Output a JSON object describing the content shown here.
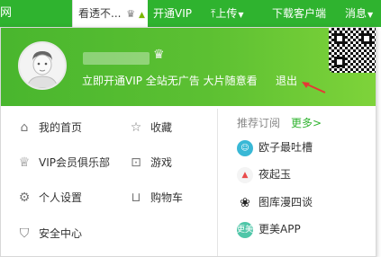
{
  "topbar": {
    "left_edge": "网",
    "user_label": "看透不...",
    "vip": "开通VIP",
    "upload": "上传",
    "download": "下载客户端",
    "message": "消息"
  },
  "header": {
    "promo": "立即开通VIP 全站无广告 大片随意看",
    "logout": "退出"
  },
  "menu": [
    {
      "icon": "home-icon",
      "label": "我的首页"
    },
    {
      "icon": "star-icon",
      "label": "收藏"
    },
    {
      "icon": "crown-icon",
      "label": "VIP会员俱乐部"
    },
    {
      "icon": "gamepad-icon",
      "label": "游戏"
    },
    {
      "icon": "gear-icon",
      "label": "个人设置"
    },
    {
      "icon": "cart-icon",
      "label": "购物车"
    },
    {
      "icon": "shield-icon",
      "label": "安全中心"
    }
  ],
  "subscriptions": {
    "title": "推荐订阅",
    "more": "更多>",
    "items": [
      {
        "label": "欧子最吐槽",
        "icon_color": "#39b8d6"
      },
      {
        "label": "夜起玉",
        "icon_color": "#e94b4b"
      },
      {
        "label": "图库漫四谈",
        "icon_color": "#222222"
      },
      {
        "label": "更美APP",
        "icon_color": "#4fc6a8",
        "icon_text": "更美"
      }
    ]
  },
  "colors": {
    "brand": "#2fb32f",
    "arrow": "#e53935"
  }
}
